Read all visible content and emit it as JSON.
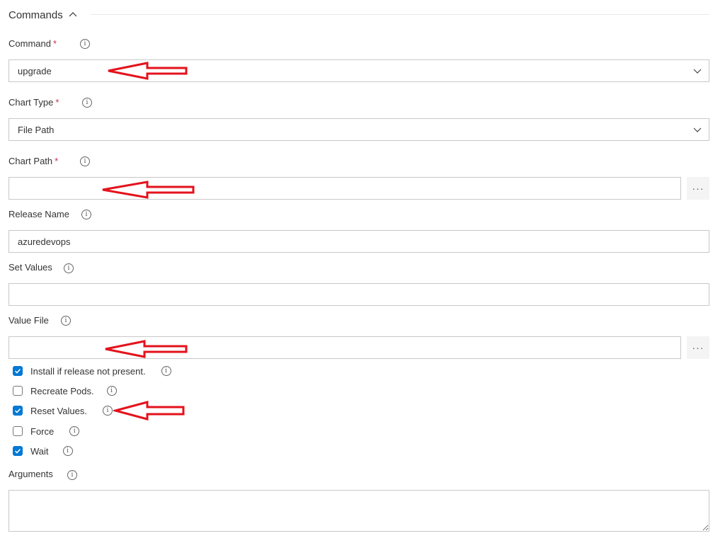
{
  "section": {
    "title": "Commands",
    "collapse_icon": "chevron-up-icon"
  },
  "fields": {
    "command": {
      "label": "Command",
      "required": "*",
      "value": "upgrade",
      "info_icon": "info-icon"
    },
    "chart_type": {
      "label": "Chart Type",
      "required": "*",
      "value": "File Path",
      "info_icon": "info-icon"
    },
    "chart_path": {
      "label": "Chart Path",
      "required": "*",
      "value": "",
      "browse_label": "···",
      "info_icon": "info-icon"
    },
    "release_name": {
      "label": "Release Name",
      "value": "azuredevops",
      "info_icon": "info-icon"
    },
    "set_values": {
      "label": "Set Values",
      "value": "",
      "info_icon": "info-icon"
    },
    "value_file": {
      "label": "Value File",
      "value": "",
      "browse_label": "···",
      "info_icon": "info-icon"
    },
    "arguments": {
      "label": "Arguments",
      "value": "",
      "info_icon": "info-icon"
    }
  },
  "checkboxes": [
    {
      "label": "Install if release not present.",
      "checked": true
    },
    {
      "label": "Recreate Pods.",
      "checked": false
    },
    {
      "label": "Reset Values.",
      "checked": true
    },
    {
      "label": "Force",
      "checked": false
    },
    {
      "label": "Wait",
      "checked": true
    }
  ],
  "annotations": {
    "arrow_color": "#e3121b",
    "accent_color": "#0078d4"
  }
}
